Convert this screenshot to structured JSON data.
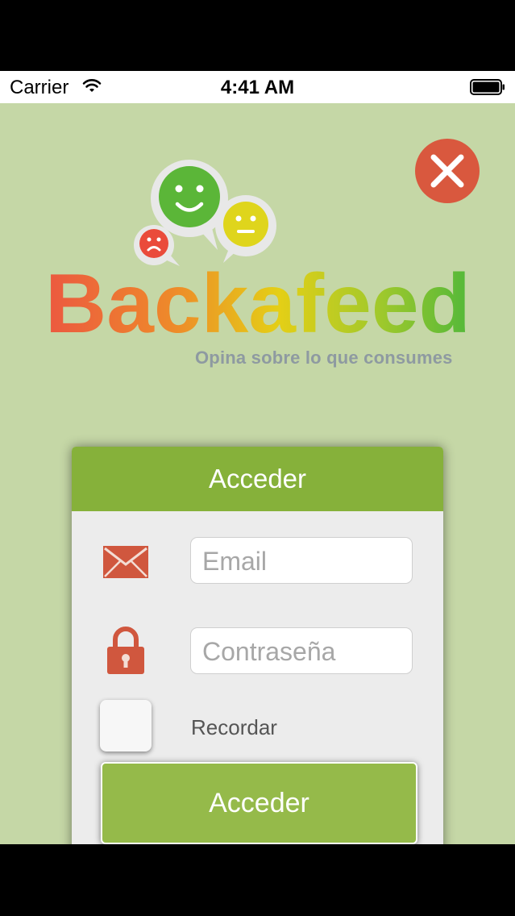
{
  "status_bar": {
    "carrier": "Carrier",
    "time": "4:41 AM"
  },
  "app": {
    "brand_name": "Backafeed",
    "tagline": "Opina sobre lo que consumes"
  },
  "login_card": {
    "title": "Acceder",
    "email_placeholder": "Email",
    "password_placeholder": "Contraseña",
    "remember_label": "Recordar",
    "remember_checked": false,
    "submit_label": "Acceder"
  },
  "icons": {
    "close": "close-icon",
    "email": "envelope-icon",
    "password": "lock-icon",
    "wifi": "wifi-icon",
    "battery": "battery-icon"
  },
  "colors": {
    "background": "#c5d7a6",
    "header_green": "#86b13a",
    "button_green": "#95ba4a",
    "close_red": "#d9583e",
    "icon_orange": "#d0573e"
  }
}
